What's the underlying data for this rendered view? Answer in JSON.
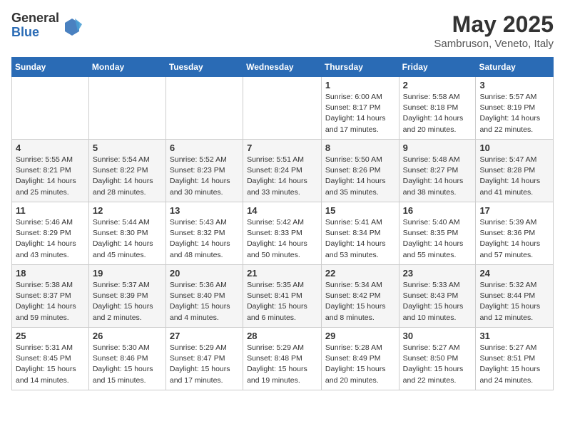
{
  "logo": {
    "general": "General",
    "blue": "Blue"
  },
  "title": "May 2025",
  "location": "Sambruson, Veneto, Italy",
  "weekdays": [
    "Sunday",
    "Monday",
    "Tuesday",
    "Wednesday",
    "Thursday",
    "Friday",
    "Saturday"
  ],
  "weeks": [
    [
      {
        "num": "",
        "info": ""
      },
      {
        "num": "",
        "info": ""
      },
      {
        "num": "",
        "info": ""
      },
      {
        "num": "",
        "info": ""
      },
      {
        "num": "1",
        "info": "Sunrise: 6:00 AM\nSunset: 8:17 PM\nDaylight: 14 hours\nand 17 minutes."
      },
      {
        "num": "2",
        "info": "Sunrise: 5:58 AM\nSunset: 8:18 PM\nDaylight: 14 hours\nand 20 minutes."
      },
      {
        "num": "3",
        "info": "Sunrise: 5:57 AM\nSunset: 8:19 PM\nDaylight: 14 hours\nand 22 minutes."
      }
    ],
    [
      {
        "num": "4",
        "info": "Sunrise: 5:55 AM\nSunset: 8:21 PM\nDaylight: 14 hours\nand 25 minutes."
      },
      {
        "num": "5",
        "info": "Sunrise: 5:54 AM\nSunset: 8:22 PM\nDaylight: 14 hours\nand 28 minutes."
      },
      {
        "num": "6",
        "info": "Sunrise: 5:52 AM\nSunset: 8:23 PM\nDaylight: 14 hours\nand 30 minutes."
      },
      {
        "num": "7",
        "info": "Sunrise: 5:51 AM\nSunset: 8:24 PM\nDaylight: 14 hours\nand 33 minutes."
      },
      {
        "num": "8",
        "info": "Sunrise: 5:50 AM\nSunset: 8:26 PM\nDaylight: 14 hours\nand 35 minutes."
      },
      {
        "num": "9",
        "info": "Sunrise: 5:48 AM\nSunset: 8:27 PM\nDaylight: 14 hours\nand 38 minutes."
      },
      {
        "num": "10",
        "info": "Sunrise: 5:47 AM\nSunset: 8:28 PM\nDaylight: 14 hours\nand 41 minutes."
      }
    ],
    [
      {
        "num": "11",
        "info": "Sunrise: 5:46 AM\nSunset: 8:29 PM\nDaylight: 14 hours\nand 43 minutes."
      },
      {
        "num": "12",
        "info": "Sunrise: 5:44 AM\nSunset: 8:30 PM\nDaylight: 14 hours\nand 45 minutes."
      },
      {
        "num": "13",
        "info": "Sunrise: 5:43 AM\nSunset: 8:32 PM\nDaylight: 14 hours\nand 48 minutes."
      },
      {
        "num": "14",
        "info": "Sunrise: 5:42 AM\nSunset: 8:33 PM\nDaylight: 14 hours\nand 50 minutes."
      },
      {
        "num": "15",
        "info": "Sunrise: 5:41 AM\nSunset: 8:34 PM\nDaylight: 14 hours\nand 53 minutes."
      },
      {
        "num": "16",
        "info": "Sunrise: 5:40 AM\nSunset: 8:35 PM\nDaylight: 14 hours\nand 55 minutes."
      },
      {
        "num": "17",
        "info": "Sunrise: 5:39 AM\nSunset: 8:36 PM\nDaylight: 14 hours\nand 57 minutes."
      }
    ],
    [
      {
        "num": "18",
        "info": "Sunrise: 5:38 AM\nSunset: 8:37 PM\nDaylight: 14 hours\nand 59 minutes."
      },
      {
        "num": "19",
        "info": "Sunrise: 5:37 AM\nSunset: 8:39 PM\nDaylight: 15 hours\nand 2 minutes."
      },
      {
        "num": "20",
        "info": "Sunrise: 5:36 AM\nSunset: 8:40 PM\nDaylight: 15 hours\nand 4 minutes."
      },
      {
        "num": "21",
        "info": "Sunrise: 5:35 AM\nSunset: 8:41 PM\nDaylight: 15 hours\nand 6 minutes."
      },
      {
        "num": "22",
        "info": "Sunrise: 5:34 AM\nSunset: 8:42 PM\nDaylight: 15 hours\nand 8 minutes."
      },
      {
        "num": "23",
        "info": "Sunrise: 5:33 AM\nSunset: 8:43 PM\nDaylight: 15 hours\nand 10 minutes."
      },
      {
        "num": "24",
        "info": "Sunrise: 5:32 AM\nSunset: 8:44 PM\nDaylight: 15 hours\nand 12 minutes."
      }
    ],
    [
      {
        "num": "25",
        "info": "Sunrise: 5:31 AM\nSunset: 8:45 PM\nDaylight: 15 hours\nand 14 minutes."
      },
      {
        "num": "26",
        "info": "Sunrise: 5:30 AM\nSunset: 8:46 PM\nDaylight: 15 hours\nand 15 minutes."
      },
      {
        "num": "27",
        "info": "Sunrise: 5:29 AM\nSunset: 8:47 PM\nDaylight: 15 hours\nand 17 minutes."
      },
      {
        "num": "28",
        "info": "Sunrise: 5:29 AM\nSunset: 8:48 PM\nDaylight: 15 hours\nand 19 minutes."
      },
      {
        "num": "29",
        "info": "Sunrise: 5:28 AM\nSunset: 8:49 PM\nDaylight: 15 hours\nand 20 minutes."
      },
      {
        "num": "30",
        "info": "Sunrise: 5:27 AM\nSunset: 8:50 PM\nDaylight: 15 hours\nand 22 minutes."
      },
      {
        "num": "31",
        "info": "Sunrise: 5:27 AM\nSunset: 8:51 PM\nDaylight: 15 hours\nand 24 minutes."
      }
    ]
  ]
}
